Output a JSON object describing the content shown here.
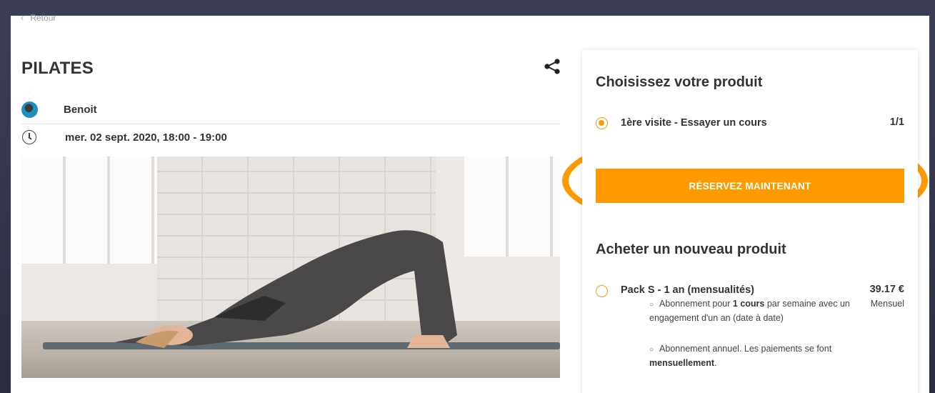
{
  "nav": {
    "back_label": "Retour"
  },
  "event": {
    "title": "PILATES",
    "instructor": "Benoit",
    "datetime": "mer. 02 sept. 2020, 18:00 - 19:00"
  },
  "panel": {
    "choose_heading": "Choisissez votre produit",
    "current_option": {
      "label": "1ère visite - Essayer un cours",
      "count": "1/1",
      "selected": true
    },
    "reserve_button": "RÉSERVEZ MAINTENANT",
    "buy_heading": "Acheter un nouveau produit",
    "products": [
      {
        "label": "Pack S - 1 an (mensualités)",
        "price": "39.17 €",
        "period": "Mensuel",
        "details": [
          {
            "prefix": "Abonnement pour ",
            "bold": "1 cours",
            "suffix": " par semaine avec un engagement d'un an (date à date)"
          },
          {
            "prefix": "Abonnement annuel. Les paiements se font ",
            "bold": "mensuellement",
            "suffix": "."
          }
        ]
      }
    ]
  },
  "colors": {
    "accent": "#ff9900",
    "text": "#333333",
    "background": "#2c2d40"
  },
  "icons": {
    "back": "chevron-left-icon",
    "share": "share-icon",
    "clock": "clock-icon"
  }
}
